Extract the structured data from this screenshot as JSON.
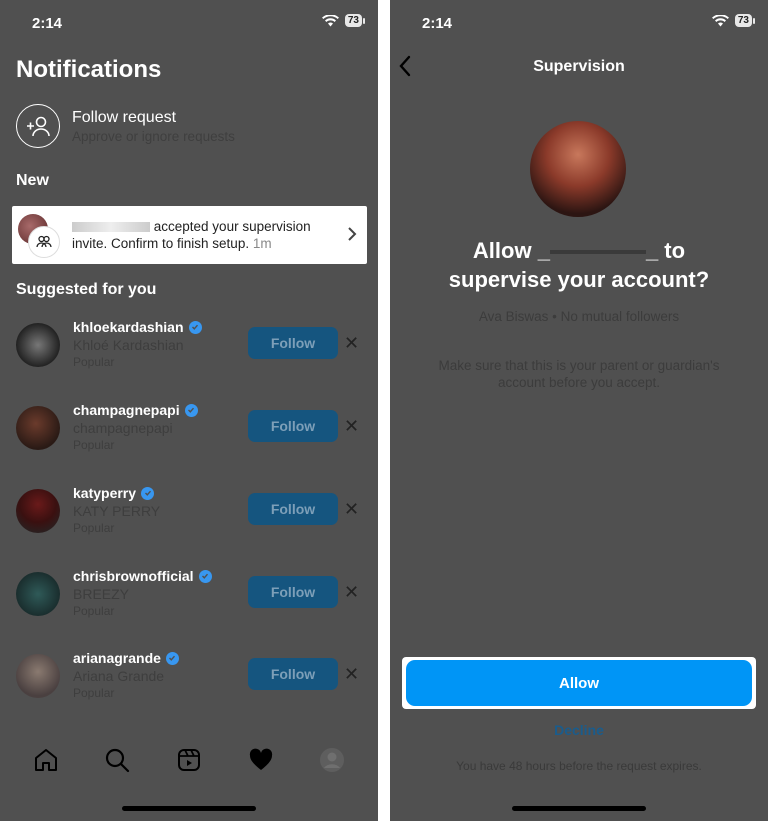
{
  "left": {
    "status": {
      "time": "2:14",
      "battery": "73"
    },
    "title": "Notifications",
    "follow_request": {
      "title": "Follow request",
      "subtitle": "Approve or ignore requests"
    },
    "section_new": "New",
    "notification": {
      "message": "accepted your supervision invite. Confirm to finish setup.",
      "time": "1m"
    },
    "section_suggested": "Suggested for you",
    "suggestions": [
      {
        "username": "khloekardashian",
        "name": "Khloé Kardashian",
        "tag": "Popular",
        "button": "Follow"
      },
      {
        "username": "champagnepapi",
        "name": "champagnepapi",
        "tag": "Popular",
        "button": "Follow"
      },
      {
        "username": "katyperry",
        "name": "KATY PERRY",
        "tag": "Popular",
        "button": "Follow"
      },
      {
        "username": "chrisbrownofficial",
        "name": "BREEZY",
        "tag": "Popular",
        "button": "Follow"
      },
      {
        "username": "arianagrande",
        "name": "Ariana Grande",
        "tag": "Popular",
        "button": "Follow"
      }
    ],
    "tabbar": [
      "home-icon",
      "search-icon",
      "reels-icon",
      "heart-icon",
      "profile-icon"
    ]
  },
  "right": {
    "status": {
      "time": "2:14",
      "battery": "73"
    },
    "nav_title": "Supervision",
    "heading_prefix": "Allow _",
    "heading_suffix": "_ to",
    "heading_line2": "supervise your account?",
    "profile_meta": "Ava Biswas • No mutual followers",
    "note": "Make sure that this is your parent or guardian's account before you accept.",
    "allow_label": "Allow",
    "decline_label": "Decline",
    "expires_text": "You have 48 hours before the request expires."
  },
  "colors": {
    "accent": "#0095f6",
    "dim_follow": "#15557f",
    "background_dim": "#505050"
  }
}
